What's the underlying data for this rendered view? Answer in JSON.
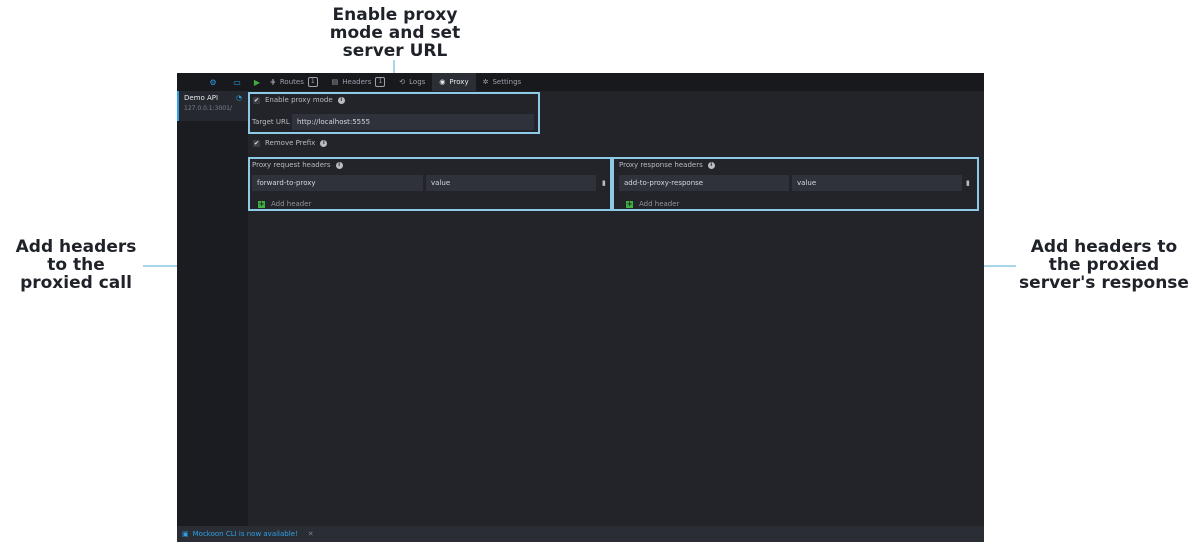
{
  "annotations": {
    "top": "Enable proxy\nmode and set\nserver URL",
    "left": "Add headers\nto the\nproxied call",
    "right": "Add headers to\nthe proxied\nserver's response"
  },
  "topbar": {
    "routes_label": "Routes",
    "routes_count": "1",
    "headers_label": "Headers",
    "headers_count": "1",
    "logs_label": "Logs",
    "proxy_label": "Proxy",
    "settings_label": "Settings"
  },
  "sidebar": {
    "env_name": "Demo API",
    "env_address": "127.0.0.1:3001/"
  },
  "proxy": {
    "enable_label": "Enable proxy mode",
    "target_url_label": "Target URL",
    "target_url_value": "http://localhost:5555",
    "remove_prefix_label": "Remove Prefix",
    "request_headers_title": "Proxy request headers",
    "request_header_key": "forward-to-proxy",
    "request_header_value": "value",
    "response_headers_title": "Proxy response headers",
    "response_header_key": "add-to-proxy-response",
    "response_header_value": "value",
    "add_header_label": "Add header"
  },
  "footer": {
    "message": "Mockoon CLI is now available!",
    "close": "✕"
  },
  "colors": {
    "accent": "#2e9fe6",
    "highlight": "#8ec9e6",
    "add_green": "#3fae3f"
  }
}
